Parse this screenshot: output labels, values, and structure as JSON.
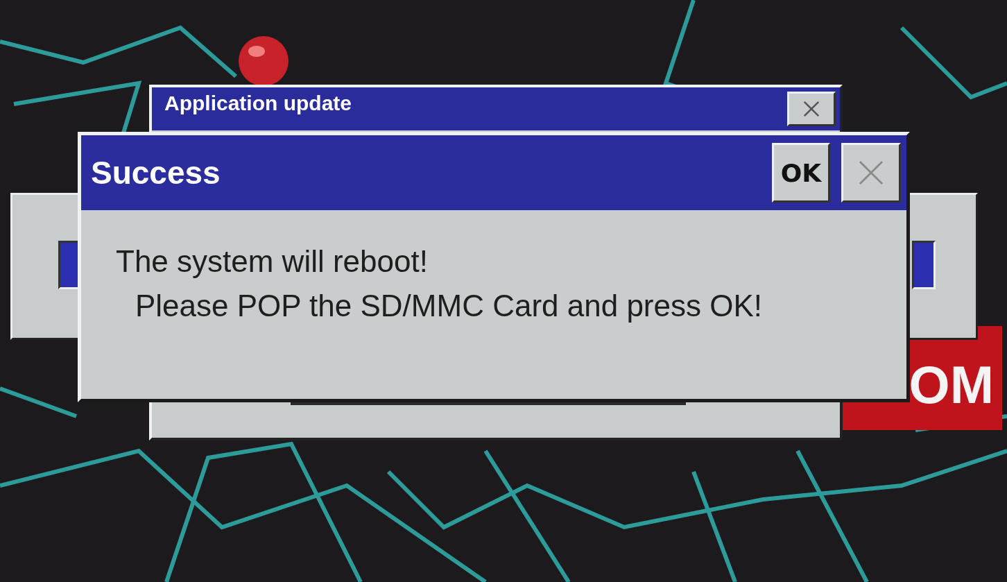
{
  "background_window": {
    "title": "Application update"
  },
  "dialog": {
    "title": "Success",
    "buttons": [
      "OK"
    ],
    "message_lines": [
      "The system will reboot!",
      "Please POP the SD/MMC Card and press OK!"
    ]
  },
  "map_banner": {
    "text": "OM"
  }
}
